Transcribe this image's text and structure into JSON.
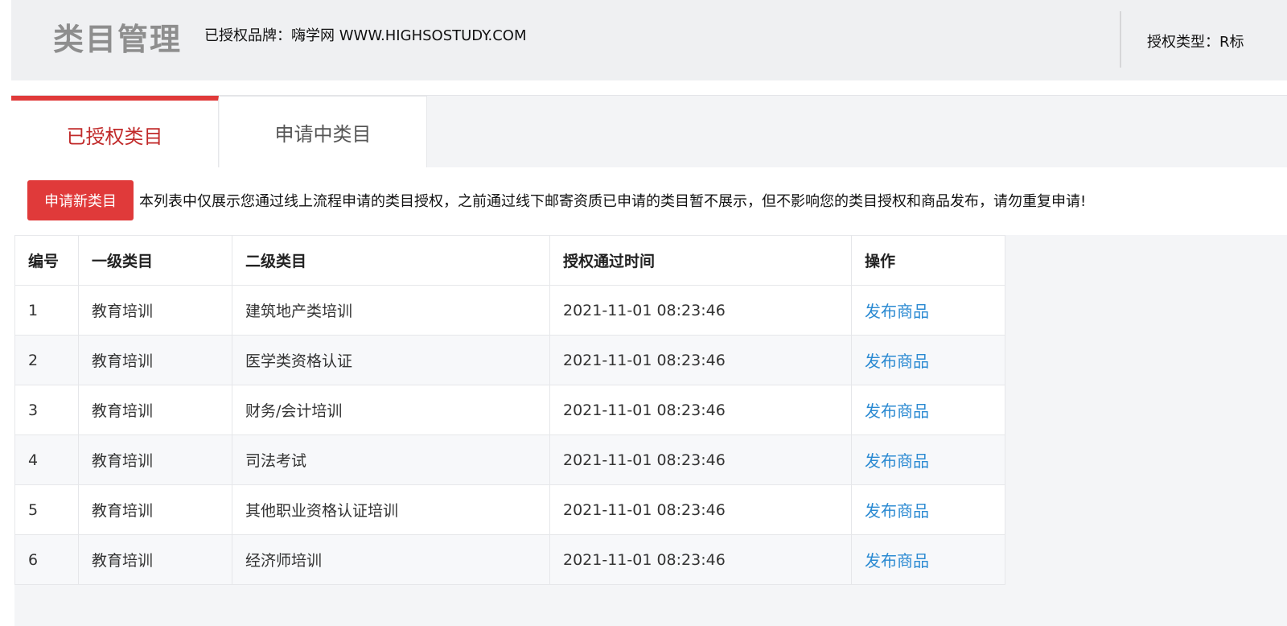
{
  "header": {
    "title": "类目管理",
    "brand_text": "已授权品牌：嗨学网 WWW.HIGHSOSTUDY.COM",
    "auth_type_text": "授权类型：R标"
  },
  "tabs": [
    {
      "label": "已授权类目",
      "active": true
    },
    {
      "label": "申请中类目",
      "active": false
    }
  ],
  "toolbar": {
    "apply_button_label": "申请新类目",
    "notice": "本列表中仅展示您通过线上流程申请的类目授权，之前通过线下邮寄资质已申请的类目暂不展示，但不影响您的类目授权和商品发布，请勿重复申请!"
  },
  "table": {
    "headers": [
      "编号",
      "一级类目",
      "二级类目",
      "授权通过时间",
      "操作"
    ],
    "rows": [
      {
        "no": "1",
        "level1": "教育培训",
        "level2": "建筑地产类培训",
        "time": "2021-11-01 08:23:46",
        "action": "发布商品"
      },
      {
        "no": "2",
        "level1": "教育培训",
        "level2": "医学类资格认证",
        "time": "2021-11-01 08:23:46",
        "action": "发布商品"
      },
      {
        "no": "3",
        "level1": "教育培训",
        "level2": "财务/会计培训",
        "time": "2021-11-01 08:23:46",
        "action": "发布商品"
      },
      {
        "no": "4",
        "level1": "教育培训",
        "level2": "司法考试",
        "time": "2021-11-01 08:23:46",
        "action": "发布商品"
      },
      {
        "no": "5",
        "level1": "教育培训",
        "level2": "其他职业资格认证培训",
        "time": "2021-11-01 08:23:46",
        "action": "发布商品"
      },
      {
        "no": "6",
        "level1": "教育培训",
        "level2": "经济师培训",
        "time": "2021-11-01 08:23:46",
        "action": "发布商品"
      }
    ]
  },
  "colors": {
    "accent_red": "#e03a3a",
    "active_tab_text": "#c12a2a",
    "link_blue": "#2b8ad2"
  }
}
